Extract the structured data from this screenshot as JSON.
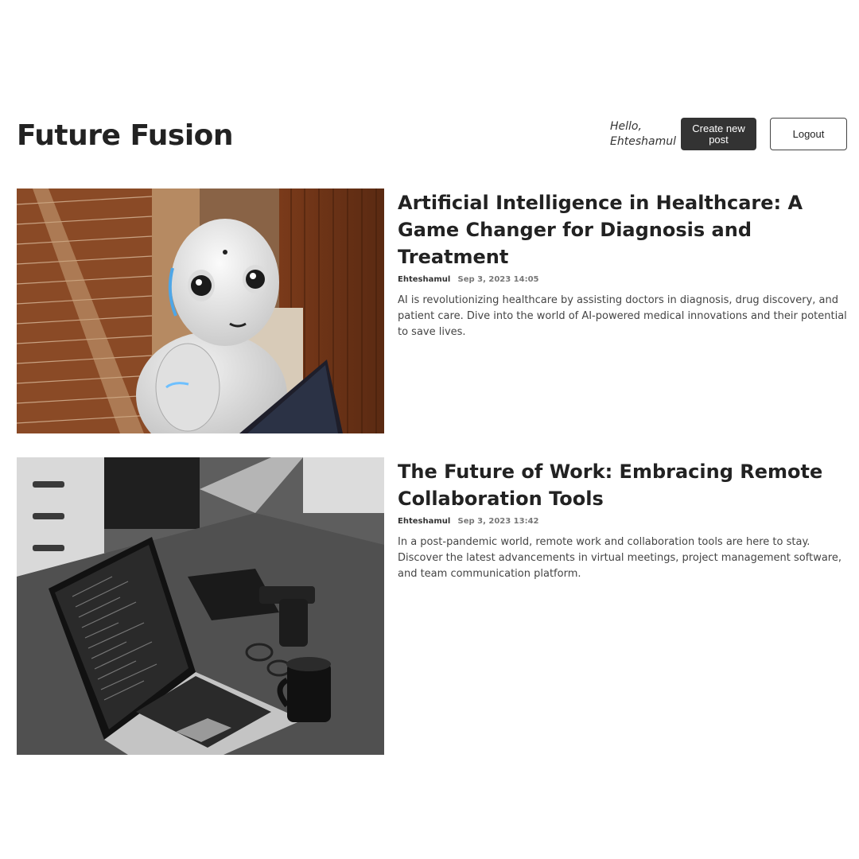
{
  "header": {
    "logo": "Future Fusion",
    "greeting_line1": "Hello,",
    "greeting_line2": "Ehteshamul",
    "create_button": "Create new post",
    "logout_button": "Logout"
  },
  "posts": [
    {
      "title": "Artificial Intelligence in Healthcare: A Game Changer for Diagnosis and Treatment",
      "author": "Ehteshamul",
      "time": "Sep 3, 2023 14:05",
      "summary": "AI is revolutionizing healthcare by assisting doctors in diagnosis, drug discovery, and patient care. Dive into the world of AI-powered medical innovations and their potential to save lives.",
      "image_icon": "robot-photo"
    },
    {
      "title": "The Future of Work: Embracing Remote Collaboration Tools",
      "author": "Ehteshamul",
      "time": "Sep 3, 2023 13:42",
      "summary": "In a post-pandemic world, remote work and collaboration tools are here to stay. Discover the latest advancements in virtual meetings, project management software, and team communication platform.",
      "image_icon": "laptop-photo"
    }
  ]
}
